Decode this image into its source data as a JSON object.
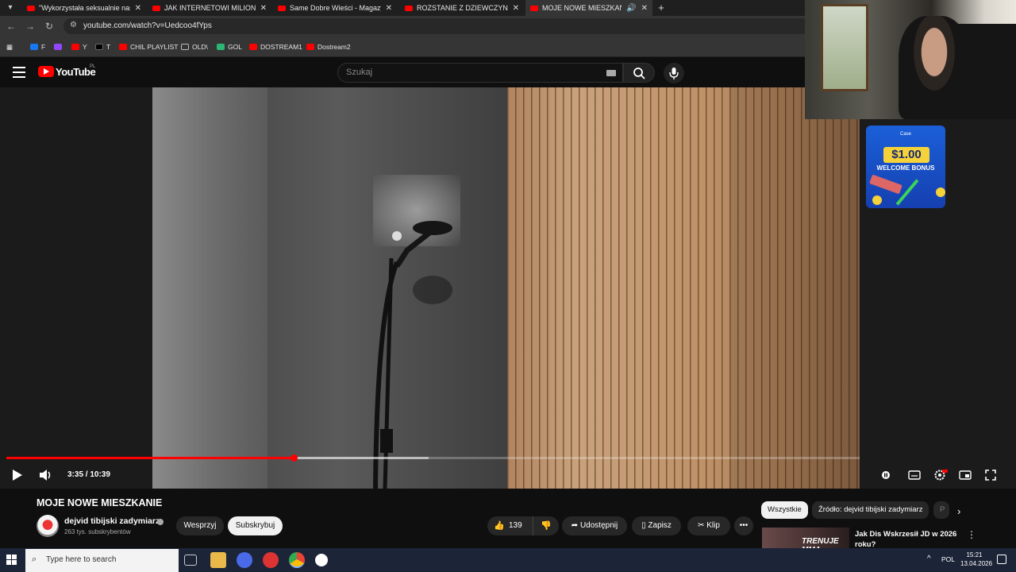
{
  "browser": {
    "tabs": [
      {
        "title": "\"Wykorzystała seksualnie nasz...",
        "active": false
      },
      {
        "title": "JAK INTERNETOWI MILIONERZY",
        "active": false
      },
      {
        "title": "Same Dobre Wieści - Magazyn",
        "active": false
      },
      {
        "title": "ROZSTANIE Z DZIEWCZYNĄ - n",
        "active": false
      },
      {
        "title": "MOJE NOWE MIESZKANIE",
        "active": true
      }
    ],
    "url": "youtube.com/watch?v=Uedcoo4fYps",
    "bookmarks": [
      {
        "label": "F",
        "color": "#1877f2"
      },
      {
        "label": "",
        "color": "#9146ff"
      },
      {
        "label": "Y",
        "color": "#ff0000"
      },
      {
        "label": "T",
        "color": "#000000"
      },
      {
        "label": "CHIL PLAYLIST",
        "color": "#ff0000"
      },
      {
        "label": "OLD\\",
        "color": "#888888"
      },
      {
        "label": "GOL",
        "color": "#2bb673"
      },
      {
        "label": "DOSTREAM1",
        "color": "#ff0000"
      },
      {
        "label": "Dostream2",
        "color": "#ff0000"
      }
    ]
  },
  "youtube": {
    "logo_text": "YouTube",
    "country": "PL",
    "search_placeholder": "Szukaj",
    "player": {
      "time": "3:35 / 10:39",
      "progress_fraction": 0.3364,
      "buffered_fraction": 0.4948
    },
    "ad": {
      "brand": "Case",
      "amount": "$1.00",
      "bonus": "WELCOME BONUS"
    },
    "video_title": "MOJE NOWE MIESZKANIE",
    "channel": {
      "name": "dejvid tibijski zadymiarz",
      "subscribers": "263 tys. subskrybentów"
    },
    "actions": {
      "support": "Wesprzyj",
      "subscribe": "Subskrybuj",
      "likes": "139",
      "share": "Udostępnij",
      "save": "Zapisz",
      "clip": "Klip",
      "more": "•••"
    },
    "chips": {
      "all": "Wszystkie",
      "source": "Źródło: dejvid tibijski zadymiarz",
      "partial": "P"
    },
    "recommendation": {
      "thumb_text": "TRENUJE MMA",
      "title": "Jak Dis Wskrzesił JD w 2026 roku?"
    }
  },
  "taskbar": {
    "search_placeholder": "Type here to search",
    "language": "POL",
    "time": "15:21",
    "date": "13.04.2026"
  },
  "colors": {
    "accent_red": "#ff0000",
    "progress_red": "#ff0000",
    "taskbar": "#1c2438"
  }
}
